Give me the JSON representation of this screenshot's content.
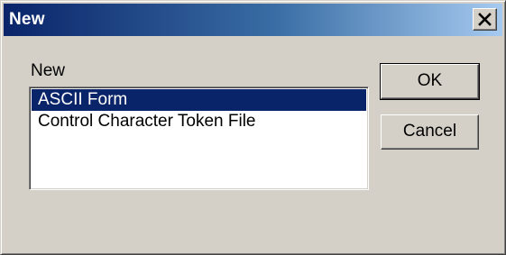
{
  "window": {
    "title": "New"
  },
  "list": {
    "label": "New",
    "items": [
      {
        "label": "ASCII Form",
        "selected": true
      },
      {
        "label": "Control Character Token File",
        "selected": false
      }
    ]
  },
  "buttons": {
    "ok_label": "OK",
    "cancel_label": "Cancel"
  },
  "colors": {
    "face": "#d4d0c8",
    "title_gradient_start": "#0a246a",
    "title_gradient_end": "#a6caf0",
    "selection": "#0a246a"
  },
  "icons": {
    "close": "close-icon"
  }
}
